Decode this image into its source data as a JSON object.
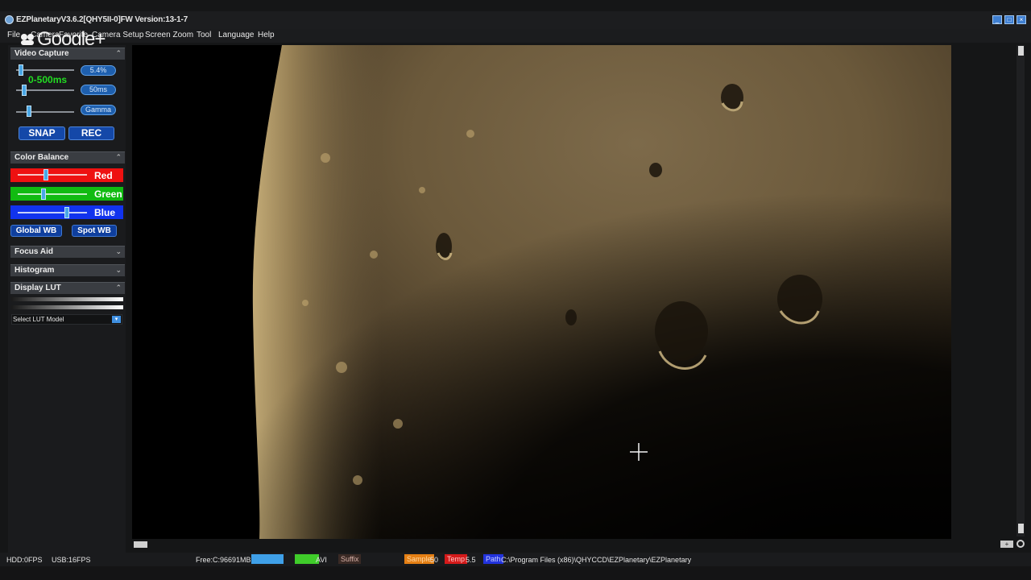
{
  "window": {
    "title": "EZPlanetaryV3.6.2[QHY5II-0]FW Version:13-1-7",
    "icon": "app-icon",
    "controls": [
      "minimize-icon",
      "maximize-icon",
      "close-icon"
    ]
  },
  "overlay": {
    "google_plus": "Google+"
  },
  "menu": {
    "items": [
      "File",
      "Camera",
      "Favorite",
      "Camera Setup",
      "Screen Zoom",
      "Tool",
      "Language",
      "Help"
    ]
  },
  "video_capture": {
    "title": "Video Capture",
    "toggle": "collapse-icon",
    "gain_value": "5.4%",
    "gain_level": 0.05,
    "exposure_range": "0-500ms",
    "exposure_value": "50ms",
    "exposure_level": 0.1,
    "gamma_label": "Gamma",
    "gamma_level": 0.2,
    "snap_label": "SNAP",
    "rec_label": "REC"
  },
  "color_balance": {
    "title": "Color Balance",
    "toggle": "collapse-icon",
    "red_label": "Red",
    "red_level": 0.4,
    "green_label": "Green",
    "green_level": 0.36,
    "blue_label": "Blue",
    "blue_level": 0.73,
    "global_wb_label": "Global WB",
    "spot_wb_label": "Spot WB",
    "colors": {
      "red": "#ee1111",
      "green": "#11bb11",
      "blue": "#1133ee"
    }
  },
  "focus_aid": {
    "title": "Focus Aid",
    "toggle": "expand-icon"
  },
  "histogram": {
    "title": "Histogram",
    "toggle": "expand-icon"
  },
  "display_lut": {
    "title": "Display LUT",
    "toggle": "collapse-icon",
    "select_label": "Select LUT Model"
  },
  "status": {
    "hdd": "HDD:0FPS",
    "usb": "USB:16FPS",
    "free": "Free:C:96691MB",
    "format": "AVI",
    "suffix": "Suffix",
    "sample_label": "Sample",
    "sample_value": "50",
    "temp_label": "Temp",
    "temp_value": "5.5",
    "path_label": "Path",
    "path_value": "C:\\Program Files (x86)\\QHYCCD\\EZPlanetary\\EZPlanetary"
  },
  "accent_color": "#3f7fd1"
}
